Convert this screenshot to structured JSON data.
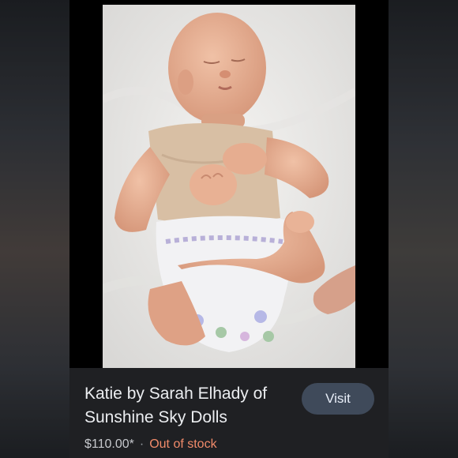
{
  "product": {
    "title": "Katie by Sarah Elhady of\nSunshine Sky Dolls",
    "price": "$110.00*",
    "separator": "·",
    "stock_status": "Out of stock",
    "visit_label": "Visit"
  },
  "colors": {
    "background": "#26282d",
    "card_info": "#1f2023",
    "visit_button": "#3f4a5a",
    "out_of_stock": "#f28b6a"
  }
}
